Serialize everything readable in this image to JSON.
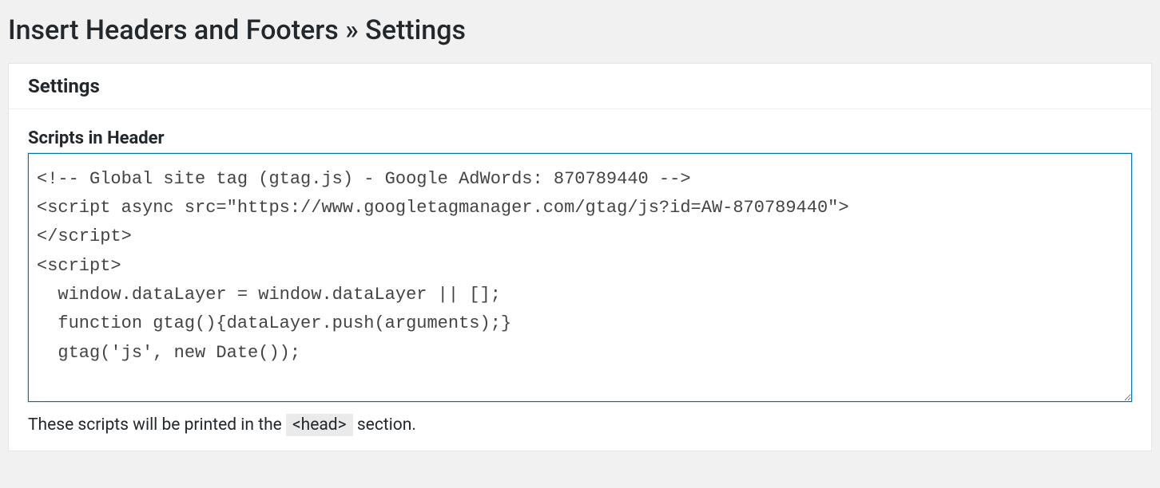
{
  "page": {
    "title": "Insert Headers and Footers » Settings"
  },
  "panel": {
    "heading": "Settings"
  },
  "header_scripts": {
    "label": "Scripts in Header",
    "value": "<!-- Global site tag (gtag.js) - Google AdWords: 870789440 -->\n<script async src=\"https://www.googletagmanager.com/gtag/js?id=AW-870789440\">\n</script>\n<script>\n  window.dataLayer = window.dataLayer || [];\n  function gtag(){dataLayer.push(arguments);}\n  gtag('js', new Date());",
    "help_prefix": "These scripts will be printed in the ",
    "help_tag": "<head>",
    "help_suffix": " section."
  }
}
